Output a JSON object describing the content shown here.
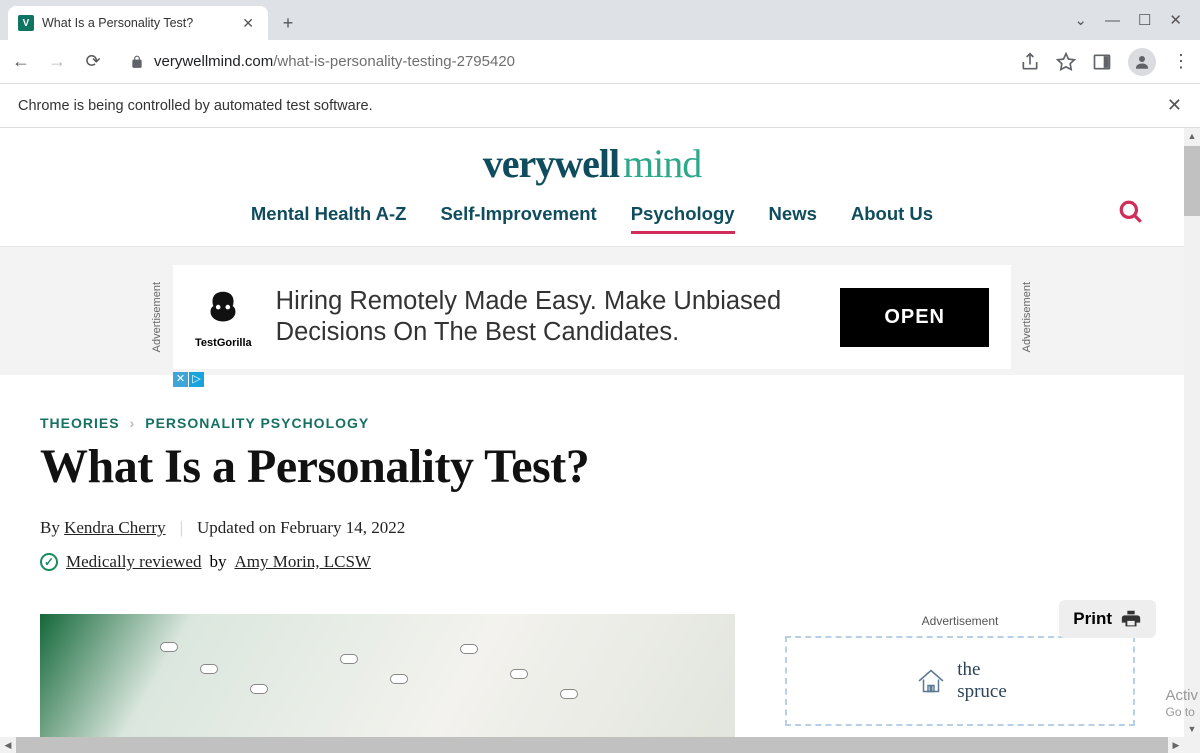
{
  "browser": {
    "tab_title": "What Is a Personality Test?",
    "url_domain": "verywellmind.com",
    "url_path": "/what-is-personality-testing-2795420",
    "info_bar": "Chrome is being controlled by automated test software."
  },
  "site": {
    "logo_primary": "verywell",
    "logo_secondary": "mind",
    "nav": [
      "Mental Health A-Z",
      "Self-Improvement",
      "Psychology",
      "News",
      "About Us"
    ],
    "active_nav_index": 2
  },
  "top_ad": {
    "label": "Advertisement",
    "brand": "TestGorilla",
    "headline": "Hiring Remotely Made Easy. Make Unbiased Decisions On The Best Candidates.",
    "cta": "OPEN"
  },
  "article": {
    "breadcrumb": [
      "THEORIES",
      "PERSONALITY PSYCHOLOGY"
    ],
    "title": "What Is a Personality Test?",
    "by_label": "By",
    "author": "Kendra Cherry",
    "updated_label": "Updated on",
    "updated_date": "February 14, 2022",
    "review_label": "Medically reviewed",
    "review_by": "by",
    "reviewer": "Amy Morin, LCSW",
    "print": "Print"
  },
  "sidebar_ad": {
    "label": "Advertisement",
    "brand_prefix": "the",
    "brand": "spruce"
  },
  "watermark": {
    "line1": "Activ",
    "line2": "Go to"
  }
}
